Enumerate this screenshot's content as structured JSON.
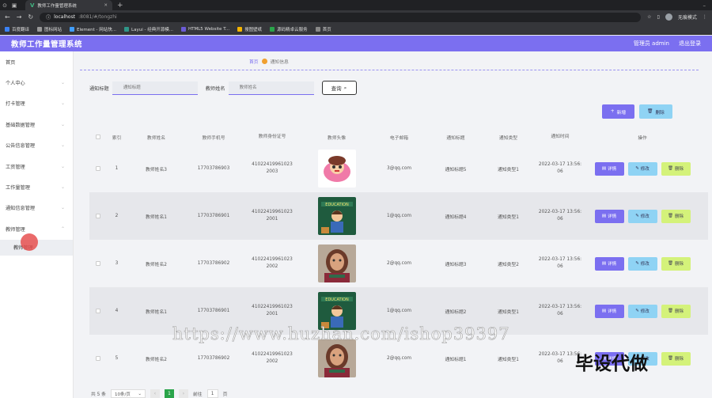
{
  "browser": {
    "tab_title": "教师工作量管理系统",
    "url_host": "localhost",
    "url_rest": ":8081/#/tongzhi",
    "profile": "无痕模式",
    "bookmarks": [
      {
        "label": "百度翻译",
        "color": "#3b82f6"
      },
      {
        "label": "图标网站",
        "color": "#555"
      },
      {
        "label": "Element - 网站快...",
        "color": "#409eff"
      },
      {
        "label": "Layui - 经典开源模...",
        "color": "#2f9688"
      },
      {
        "label": "HTML5 Website T...",
        "color": "#6b5bd6"
      },
      {
        "label": "搜图壁纸",
        "color": "#f5b400"
      },
      {
        "label": "源码精卓云服务",
        "color": "#2aa44a"
      },
      {
        "label": "首页",
        "color": "#888"
      }
    ]
  },
  "header": {
    "title": "教师工作量管理系统",
    "user": "管理员 admin",
    "logout": "退出登录"
  },
  "sidebar": {
    "items": [
      "首页",
      "个人中心",
      "打卡管理",
      "基础数据管理",
      "公告信息管理",
      "工资管理",
      "工作量管理",
      "通知信息管理",
      "教师管理"
    ],
    "sub_item": "教师管理"
  },
  "breadcrumb": {
    "home": "首页",
    "current": "通知信息"
  },
  "search": {
    "title_label": "通知标题",
    "title_placeholder": "通知标题",
    "name_label": "教师姓名",
    "name_placeholder": "教师姓名",
    "query_label": "查询"
  },
  "actions": {
    "add_label": "新增",
    "delete_label": "删除"
  },
  "table": {
    "headers": [
      "索引",
      "教师姓名",
      "教师手机号",
      "教师身份证号",
      "教师头像",
      "电子邮箱",
      "通知标题",
      "通知类型",
      "通知时间",
      "操作"
    ],
    "ops": {
      "detail": "详情",
      "edit": "修改",
      "delete": "删除"
    },
    "rows": [
      {
        "index": "1",
        "name": "教师姓名3",
        "phone": "17703786903",
        "id_line1": "41022419961023",
        "id_line2": "2003",
        "email": "3@qq.com",
        "title": "通知标题5",
        "type": "通知类型1",
        "time_line1": "2022-03-17 13:56:",
        "time_line2": "06",
        "thumb": "a"
      },
      {
        "index": "2",
        "name": "教师姓名1",
        "phone": "17703786901",
        "id_line1": "41022419961023",
        "id_line2": "2001",
        "email": "1@qq.com",
        "title": "通知标题4",
        "type": "通知类型1",
        "time_line1": "2022-03-17 13:56:",
        "time_line2": "06",
        "thumb": "b"
      },
      {
        "index": "3",
        "name": "教师姓名2",
        "phone": "17703786902",
        "id_line1": "41022419961023",
        "id_line2": "2002",
        "email": "2@qq.com",
        "title": "通知标题3",
        "type": "通知类型2",
        "time_line1": "2022-03-17 13:56:",
        "time_line2": "06",
        "thumb": "c"
      },
      {
        "index": "4",
        "name": "教师姓名1",
        "phone": "17703786901",
        "id_line1": "41022419961023",
        "id_line2": "2001",
        "email": "1@qq.com",
        "title": "通知标题2",
        "type": "通知类型1",
        "time_line1": "2022-03-17 13:56:",
        "time_line2": "06",
        "thumb": "b"
      },
      {
        "index": "5",
        "name": "教师姓名2",
        "phone": "17703786902",
        "id_line1": "41022419961023",
        "id_line2": "2002",
        "email": "2@qq.com",
        "title": "通知标题1",
        "type": "通知类型1",
        "time_line1": "2022-03-17 13:56:",
        "time_line2": "06",
        "thumb": "c"
      }
    ]
  },
  "pager": {
    "total": "共 5 条",
    "size": "10条/页",
    "current": "1",
    "goto_label": "前往",
    "goto_value": "1",
    "page_suffix": "页"
  },
  "watermark": {
    "url": "https://www.huzhan.com/ishop39397",
    "cn": "毕设代做"
  },
  "colors": {
    "accent": "#7b6ff0",
    "edit": "#8fd3f4",
    "delete": "#d4f27a",
    "pager_active": "#2aa44a"
  }
}
